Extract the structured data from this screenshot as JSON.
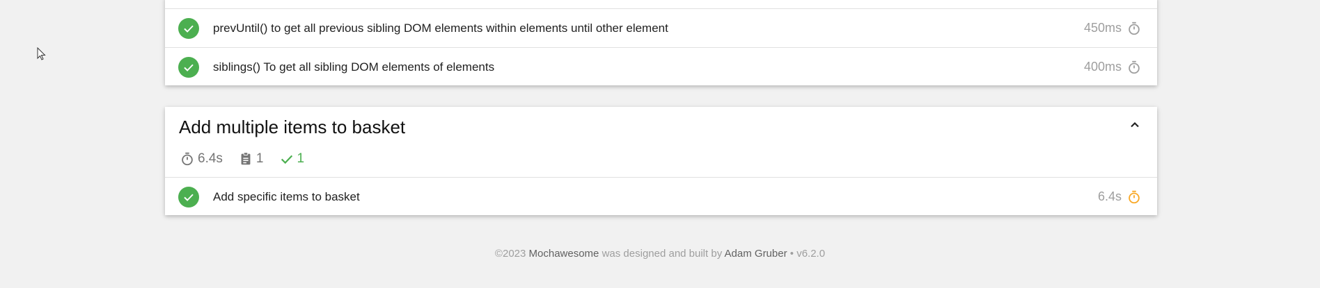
{
  "top_suite": {
    "tests": [
      {
        "title": "prevUntil() to get all previous sibling DOM elements within elements until other element",
        "duration": "450ms",
        "speed": "medium"
      },
      {
        "title": "siblings() To get all sibling DOM elements of elements",
        "duration": "400ms",
        "speed": "medium"
      }
    ]
  },
  "bottom_suite": {
    "title": "Add multiple items to basket",
    "summary": {
      "duration": "6.4s",
      "tests_count": "1",
      "passes_count": "1"
    },
    "tests": [
      {
        "title": "Add specific items to basket",
        "duration": "6.4s",
        "speed": "slow"
      }
    ]
  },
  "footer": {
    "copyright": "©2023",
    "brand": "Mochawesome",
    "middle_text": "was designed and built by",
    "author": "Adam Gruber",
    "separator": "•",
    "version": "v6.2.0"
  },
  "colors": {
    "pass": "#4caf50",
    "timer_medium": "#9e9e9e",
    "timer_slow": "#f9a825",
    "background": "#f1f1f1"
  }
}
